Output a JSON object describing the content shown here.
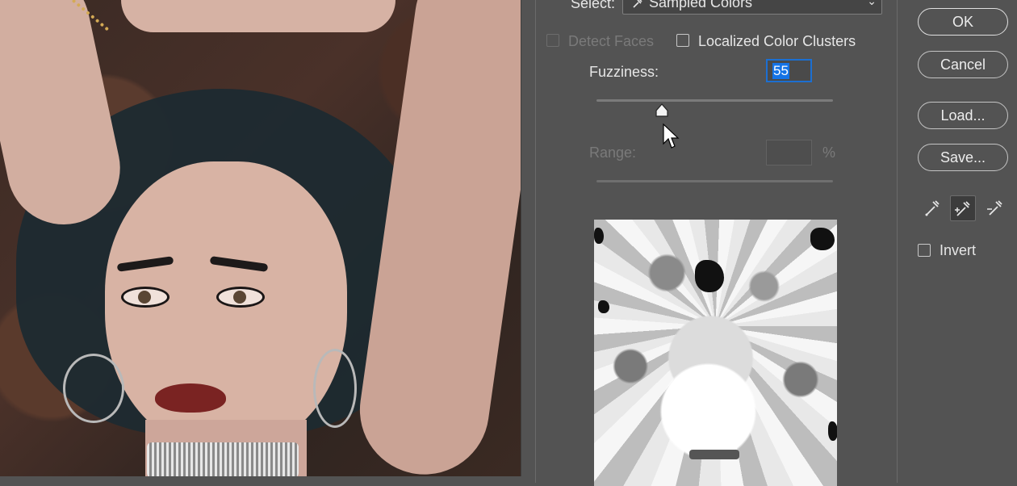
{
  "dialog": {
    "select_label": "Select:",
    "select_value": "Sampled Colors",
    "detect_faces_label": "Detect Faces",
    "localized_label": "Localized Color Clusters",
    "fuzziness_label": "Fuzziness:",
    "fuzziness_value": "55",
    "fuzziness_level": 0.275,
    "range_label": "Range:",
    "range_value": "",
    "range_unit": "%",
    "invert_label": "Invert"
  },
  "buttons": {
    "ok": "OK",
    "cancel": "Cancel",
    "load": "Load...",
    "save": "Save..."
  },
  "icons": [
    "eyedropper-icon",
    "eyedropper-plus-icon",
    "eyedropper-minus-icon",
    "dropdown-chevron-icon"
  ],
  "colors": {
    "dialog_bg": "#535353",
    "focus": "#1473e6"
  }
}
